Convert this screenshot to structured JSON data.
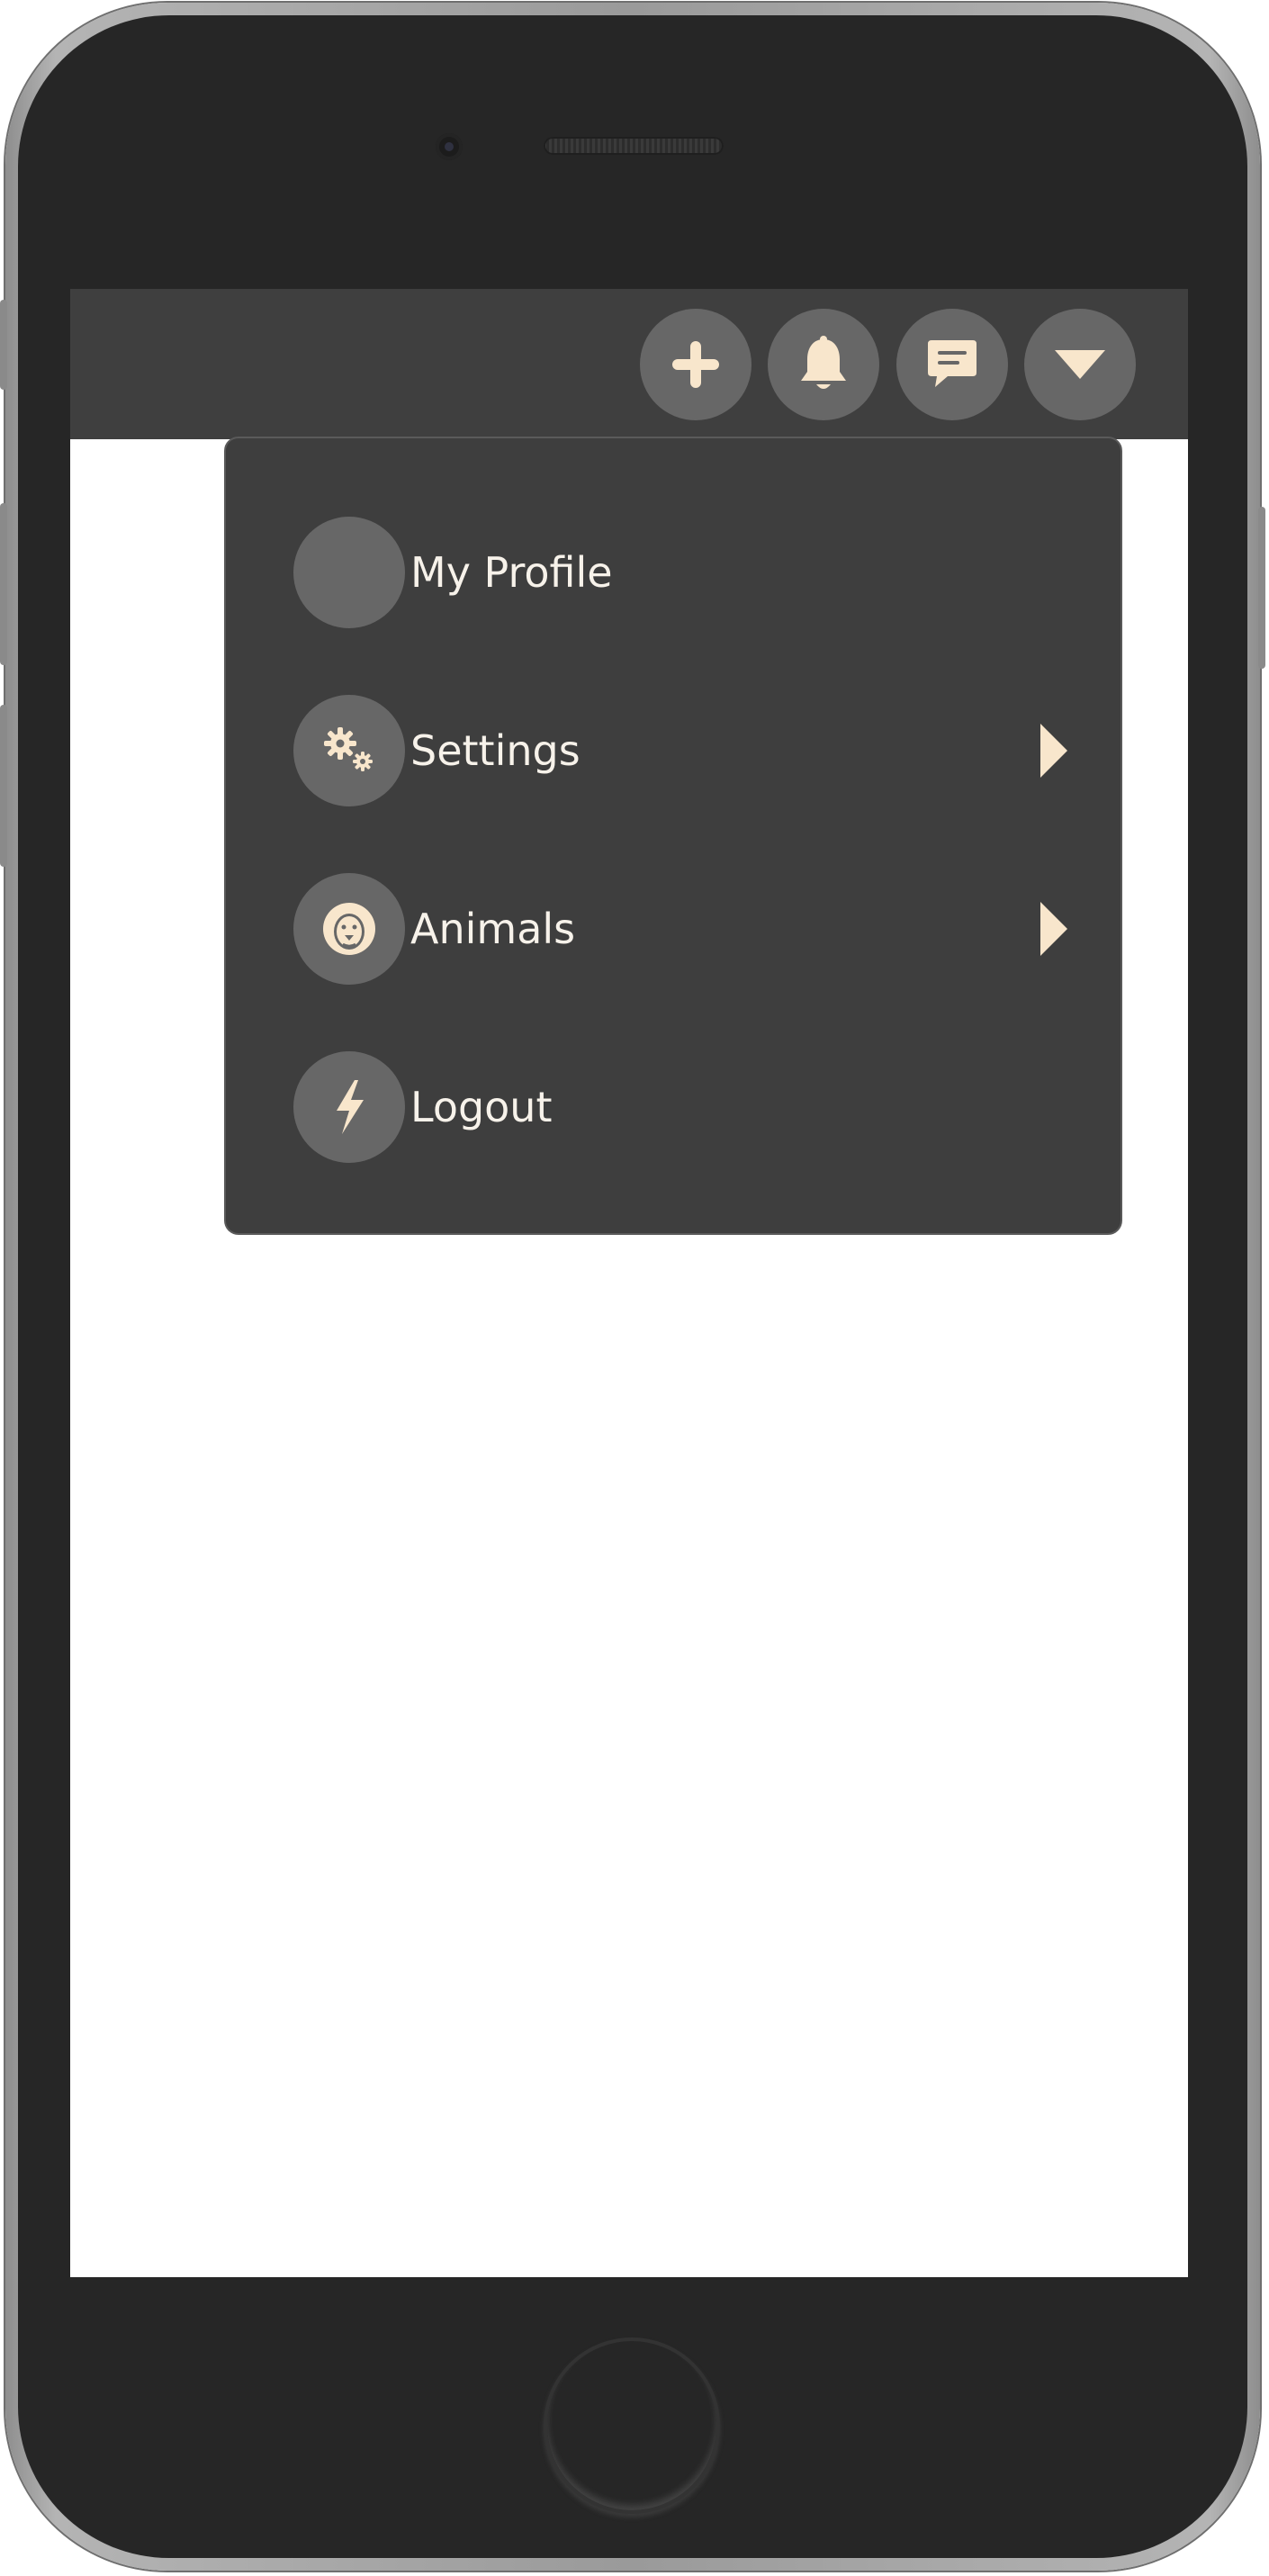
{
  "colors": {
    "accent": "#f8e6cc",
    "topbar": "#3f3f3f",
    "menu_background": "#3e3e3e",
    "icon_circle": "#676767",
    "menu_text": "#f7f2ea"
  },
  "topbar": {
    "buttons": [
      {
        "icon": "plus-icon"
      },
      {
        "icon": "bell-icon"
      },
      {
        "icon": "chat-icon"
      },
      {
        "icon": "caret-down-icon"
      }
    ]
  },
  "menu": {
    "items": [
      {
        "label": "My Profile",
        "icon": "avatar",
        "submenu": false
      },
      {
        "label": "Settings",
        "icon": "gears-icon",
        "submenu": true
      },
      {
        "label": "Animals",
        "icon": "lion-icon",
        "submenu": true
      },
      {
        "label": "Logout",
        "icon": "bolt-icon",
        "submenu": false
      }
    ]
  }
}
